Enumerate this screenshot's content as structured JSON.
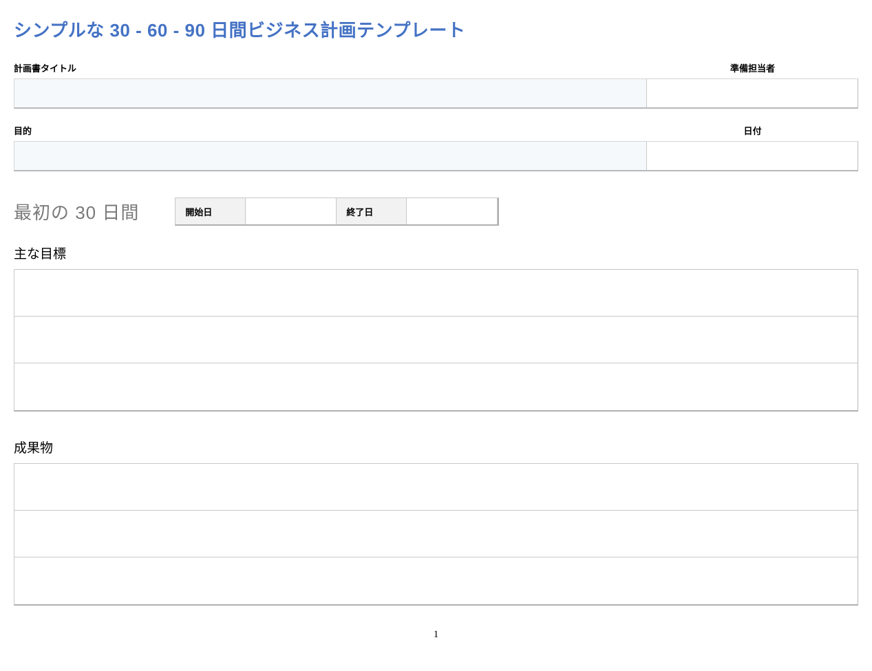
{
  "page_title": "シンプルな 30 - 60 - 90 日間ビジネス計画テンプレート",
  "header1": {
    "left_label": "計画書タイトル",
    "right_label": "準備担当者",
    "left_value": "",
    "right_value": ""
  },
  "header2": {
    "left_label": "目的",
    "right_label": "日付",
    "left_value": "",
    "right_value": ""
  },
  "section_title": "最初の 30 日間",
  "dates": {
    "start_label": "開始日",
    "end_label": "終了日",
    "start_value": "",
    "end_value": ""
  },
  "goals_heading": "主な目標",
  "goals": [
    "",
    "",
    ""
  ],
  "deliverables_heading": "成果物",
  "deliverables": [
    "",
    "",
    ""
  ],
  "page_number": "1"
}
